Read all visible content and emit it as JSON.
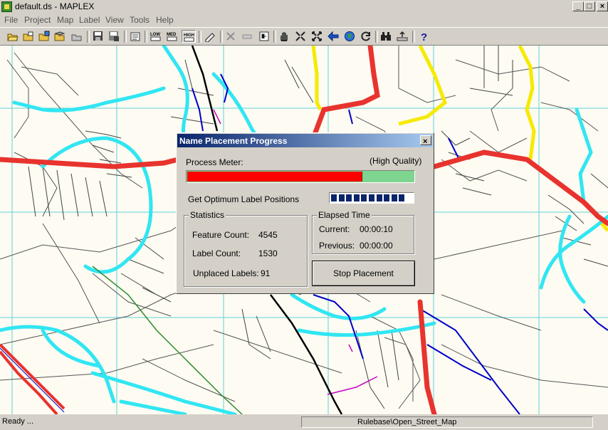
{
  "window": {
    "title": "default.ds - MAPLEX",
    "minimize_glyph": "_",
    "maximize_glyph": "□",
    "close_glyph": "×"
  },
  "menu": [
    "File",
    "Project",
    "Map",
    "Label",
    "View",
    "Tools",
    "Help"
  ],
  "toolbar": {
    "buttons": [
      "open-folder-icon",
      "open-project-icon",
      "open-map-icon",
      "open-layers-icon",
      "open-rules-icon",
      "save-icon",
      "save-all-icon",
      "properties-icon",
      "quality-low",
      "quality-medium",
      "quality-high",
      "label-edit-icon",
      "place-icon",
      "measure-icon",
      "fixed-label-icon",
      "pan-hand-icon",
      "zoom-in-icon",
      "zoom-full-extent-icon",
      "back-arrow-icon",
      "globe-icon",
      "refresh-icon",
      "find-binoculars-icon",
      "export-icon",
      "help-icon"
    ],
    "quality_low_label": "LOW",
    "quality_med_label": "MED",
    "quality_high_label": "HIGH",
    "help_label": "?"
  },
  "dialog": {
    "title": "Name Placement Progress",
    "close_glyph": "×",
    "process_meter_label": "Process Meter:",
    "quality_label": "(High Quality)",
    "process_progress": 0.77,
    "task_label": "Get Optimum Label Positions",
    "task_progress_blocks": 10,
    "statistics": {
      "title": "Statistics",
      "feature_count_label": "Feature Count:",
      "feature_count": "4545",
      "label_count_label": "Label Count:",
      "label_count": "1530",
      "unplaced_label": "Unplaced Labels:",
      "unplaced_count": "91"
    },
    "elapsed": {
      "title": "Elapsed Time",
      "current_label": "Current:",
      "current_value": "00:00:10",
      "previous_label": "Previous:",
      "previous_value": "00:00:00"
    },
    "stop_button": "Stop Placement"
  },
  "status": {
    "left": "Ready ...",
    "right": "Rulebase\\Open_Street_Map"
  },
  "colors": {
    "map_bg": "#fdfbf2",
    "grid": "#5fd0d8",
    "water": "#31e6f2",
    "major_road": "#e8332e",
    "secondary_road": "#f5ea00",
    "rail": "#000000",
    "stream": "#0000c8",
    "path": "#c800c8",
    "boundary": "#2e8b2e"
  }
}
